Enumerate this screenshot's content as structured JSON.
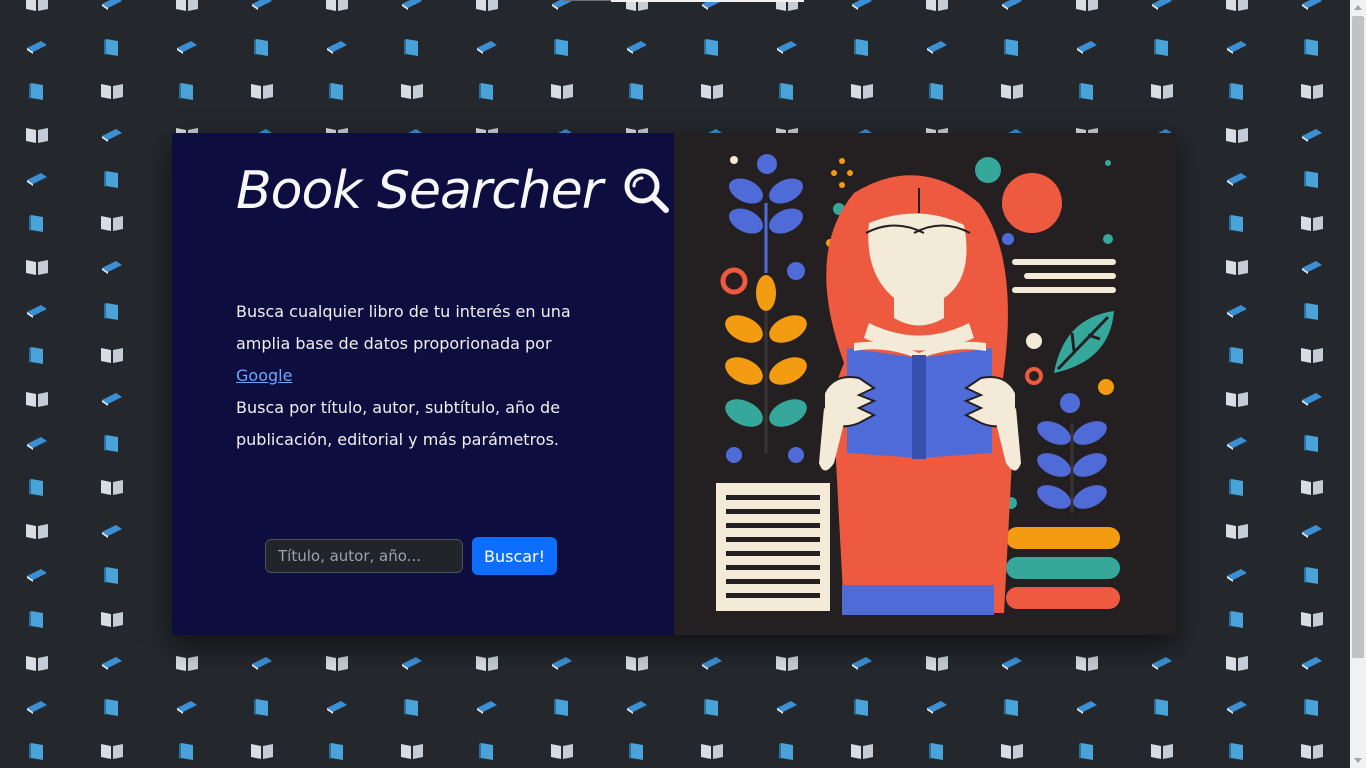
{
  "app": {
    "title": "Book Searcher"
  },
  "intro": {
    "text_before_link": "Busca cualquier libro de tu interés en una amplia base de datos proporionada por",
    "link_label": "Google",
    "text_after_link": "Busca por título, autor, subtítulo, año de publicación, editorial y más parámetros."
  },
  "search": {
    "placeholder": "Título, autor, año...",
    "value": "",
    "button_label": "Buscar!"
  },
  "icons": {
    "title_icon": "magnifier-icon",
    "illustration": "woman-reading-book-illustration",
    "background": "book-pattern-icons"
  },
  "colors": {
    "page_background": "#212529",
    "left_panel": "#0d0d3f",
    "right_panel": "#241f21",
    "button": "#0d6efd",
    "link": "#6ea8fe"
  }
}
